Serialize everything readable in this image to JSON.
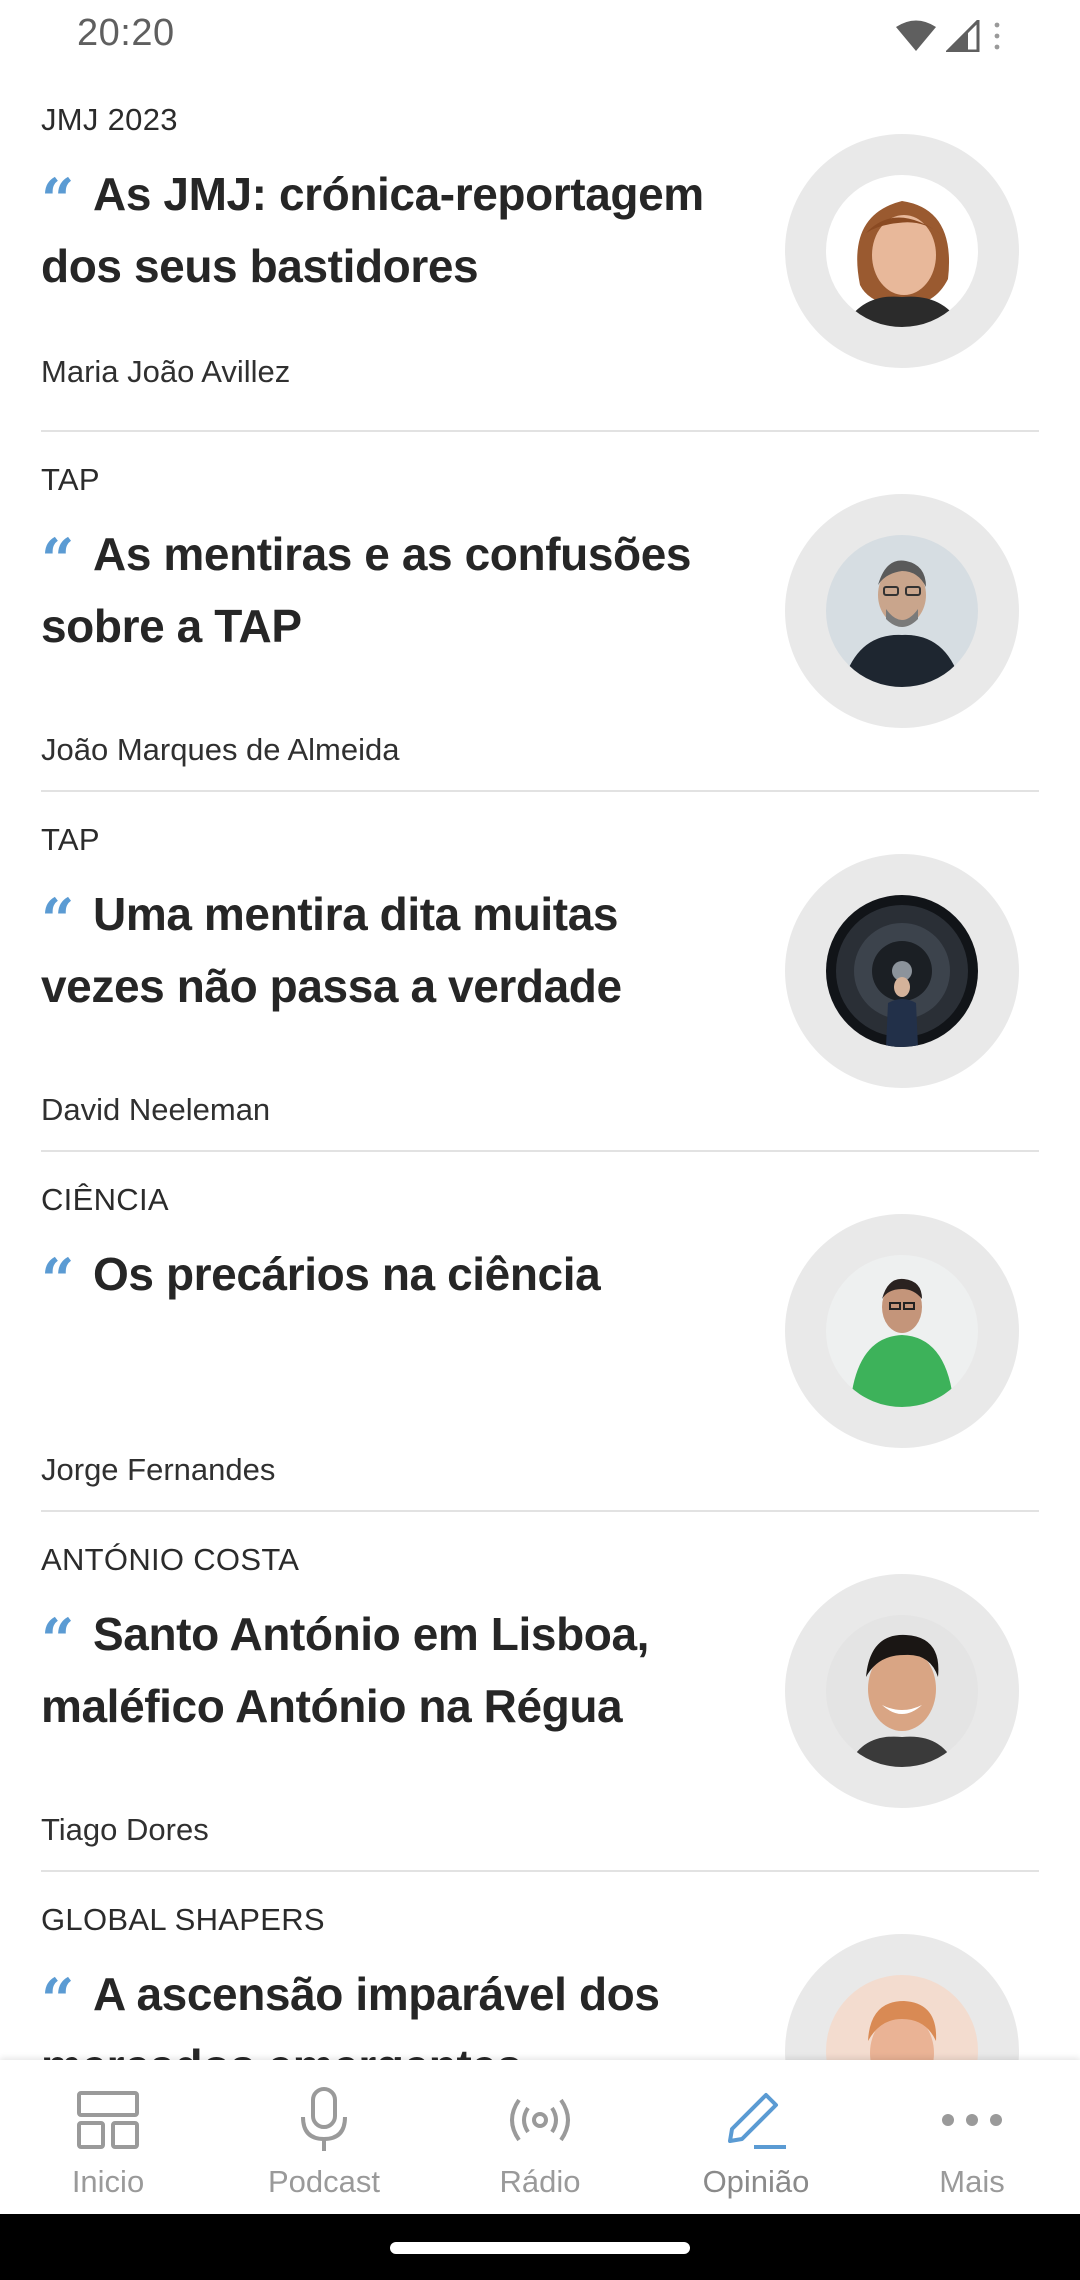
{
  "status_bar": {
    "time": "20:20"
  },
  "articles": [
    {
      "category": "JMJ 2023",
      "title": "As JMJ: crónica-reportagem dos seus bastidores",
      "author": "Maria João Avillez",
      "avatar": "woman-portrait"
    },
    {
      "category": "TAP",
      "title": "As mentiras e as confusões sobre a TAP",
      "author": "João Marques de Almeida",
      "avatar": "man-glasses-portrait"
    },
    {
      "category": "TAP",
      "title": "Uma mentira dita muitas vezes não passa a verdade",
      "author": "David Neeleman",
      "avatar": "man-jet-engine-portrait"
    },
    {
      "category": "CIÊNCIA",
      "title": "Os precários na ciência",
      "author": "Jorge Fernandes",
      "avatar": "man-green-sweater-portrait"
    },
    {
      "category": "ANTÓNIO COSTA",
      "title": "Santo António em Lisboa, maléfico António na Régua",
      "author": "Tiago Dores",
      "avatar": "man-smiling-portrait"
    },
    {
      "category": "GLOBAL SHAPERS",
      "title": "A ascensão imparável dos mercados emergentes",
      "author": "",
      "avatar": "man-blond-portrait"
    }
  ],
  "nav": {
    "items": [
      {
        "label": "Inicio",
        "icon": "dashboard-icon"
      },
      {
        "label": "Podcast",
        "icon": "microphone-icon"
      },
      {
        "label": "Rádio",
        "icon": "radio-broadcast-icon"
      },
      {
        "label": "Opinião",
        "icon": "pen-icon",
        "active": true
      },
      {
        "label": "Mais",
        "icon": "more-dots-icon"
      }
    ]
  },
  "colors": {
    "accent": "#5b9bd3",
    "nav_inactive": "#9a9a9a",
    "divider": "#e2e2e2",
    "avatar_ring": "#e9e9e9"
  }
}
